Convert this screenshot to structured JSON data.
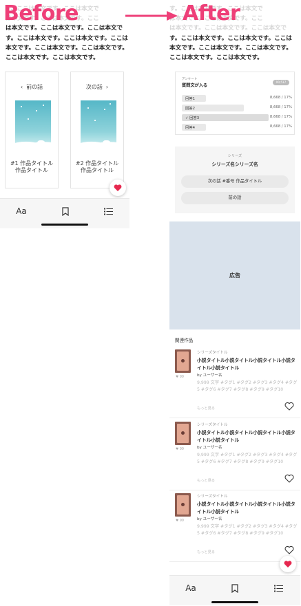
{
  "labels": {
    "before": "Before",
    "after": "After"
  },
  "colors": {
    "accent": "#ee3f78",
    "ad_bg": "#d9e2ec",
    "heart": "#e6284f"
  },
  "before": {
    "text_lines_faded": [
      "す。ここは本文です。ここは本文で",
      "は本文です。ここは本文です。ここ"
    ],
    "text_lines": [
      "は本文です。ここは本文です。ここは本文で",
      "す。ここは本文です。ここは本文です。ここは",
      "本文です。ここは本文です。ここは本文です。",
      "ここは本文です。ここは本文です。"
    ],
    "prev_label": "前の話",
    "next_label": "次の話",
    "prev_title": "#1 作品タイトル作品タイトル",
    "next_title": "#2 作品タイトル作品タイトル"
  },
  "after": {
    "text_lines_faded": [
      "す。ここは本文です。ここは本文で",
      "は本文です。ここは本文です。ここ",
      "は本文です。ここは本文です。ここは本文で"
    ],
    "text_lines": [
      "す。ここは本文です。ここは本文です。ここは",
      "本文です。ここは本文です。ここは本文です。",
      "ここは本文です。ここは本文です。"
    ],
    "poll": {
      "small": "アンケート",
      "question": "質問文が入る",
      "badge": "00,517",
      "options": [
        {
          "label": "回答1",
          "pct": "8,668 / 17%",
          "bar": 0.23,
          "checked": false
        },
        {
          "label": "回答2",
          "pct": "8,668 / 17%",
          "bar": 0.6,
          "checked": false
        },
        {
          "label": "✓ 回答3",
          "pct": "8,668 / 17%",
          "bar": 0.84,
          "checked": true
        },
        {
          "label": "回答4",
          "pct": "8,668 / 17%",
          "bar": 0.23,
          "checked": false
        }
      ]
    },
    "series": {
      "small": "シリーズ",
      "name": "シリーズ名シリーズ名",
      "next_btn": "次の話 #番号 作品タイトル",
      "prev_btn": "前の話"
    },
    "ad_label": "広告",
    "related_heading": "関連作品",
    "works": [
      {
        "series": "シリーズタイトル",
        "title": "小説タイトル小説タイトル小説タイトル小説タイトル小説タイトル",
        "by": "by ユーザー名",
        "likes": "♥ 99",
        "tags": "9,999 文字 #タグ1 #タグ2 #タグ3 #タグ4 #タグ5 #タグ6 #タグ7 #タグ8 #タグ9 #タグ10",
        "more": "もっと見る"
      },
      {
        "series": "シリーズタイトル",
        "title": "小説タイトル小説タイトル小説タイトル小説タイトル小説タイトル",
        "by": "by ユーザー名",
        "likes": "♥ 99",
        "tags": "9,999 文字 #タグ1 #タグ2 #タグ3 #タグ4 #タグ5 #タグ6 #タグ7 #タグ8 #タグ9 #タグ10",
        "more": "もっと見る"
      },
      {
        "series": "シリーズタイトル",
        "title": "小説タイトル小説タイトル小説タイトル小説タイトル小説タイトル",
        "by": "by ユーザー名",
        "likes": "♥ 99",
        "tags": "9,999 文字 #タグ1 #タグ2 #タグ3 #タグ4 #タグ5 #タグ6 #タグ7 #タグ8 #タグ9 #タグ10",
        "more": "もっと見る"
      }
    ]
  },
  "toolbar": {
    "font_label": "Aa",
    "icons": [
      "bookmark-icon",
      "list-icon"
    ]
  }
}
